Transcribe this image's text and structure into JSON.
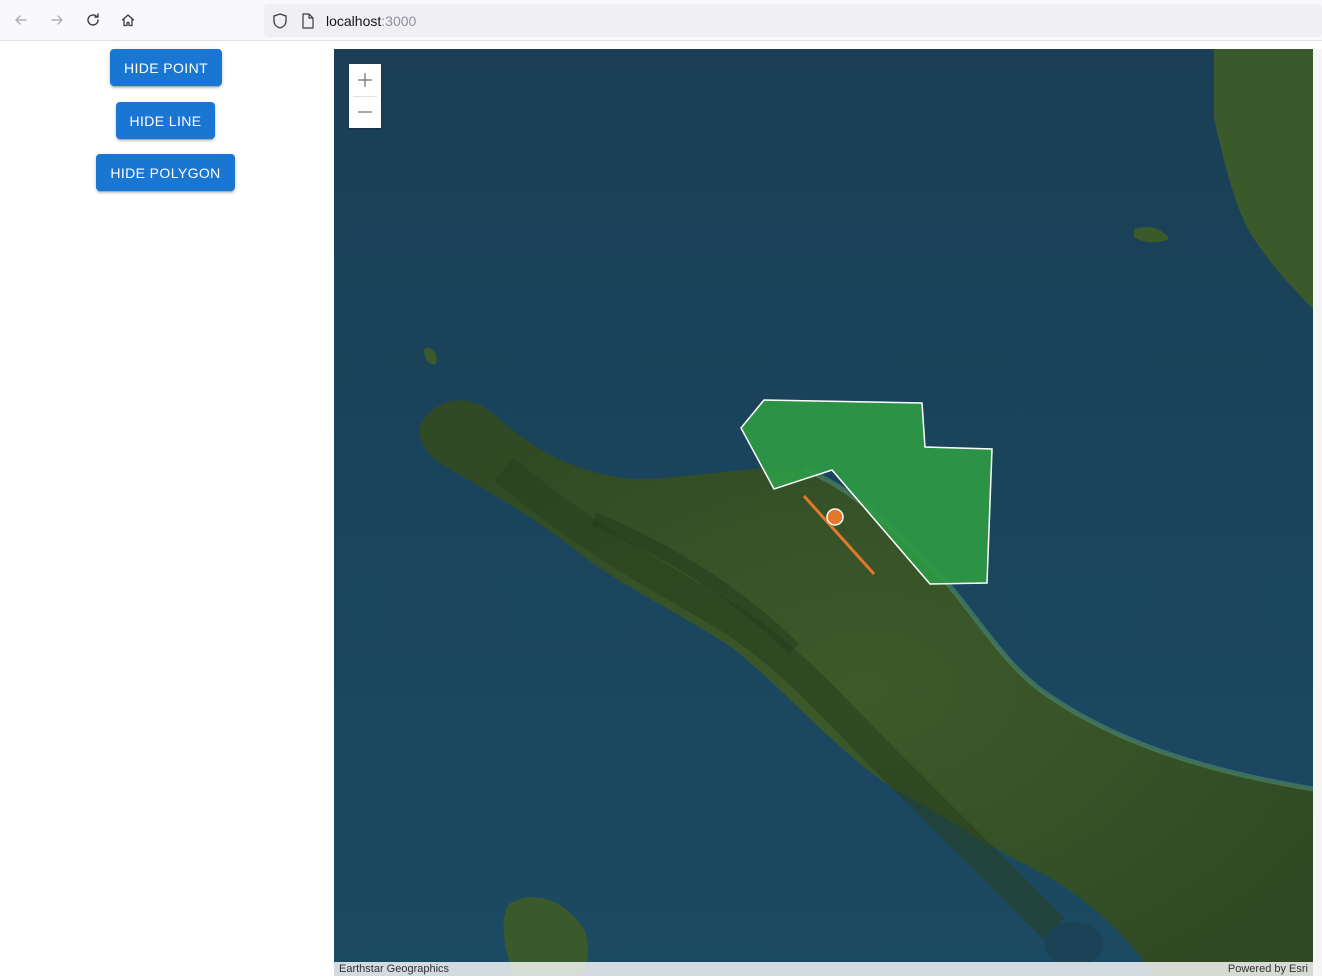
{
  "browser": {
    "url_host": "localhost",
    "url_port": ":3000"
  },
  "sidebar": {
    "buttons": [
      {
        "label": "HIDE POINT"
      },
      {
        "label": "HIDE LINE"
      },
      {
        "label": "HIDE POLYGON"
      }
    ]
  },
  "map": {
    "zoom_in_icon": "plus-icon",
    "zoom_out_icon": "minus-icon",
    "attribution_left": "Earthstar Geographics",
    "attribution_right": "Powered by Esri",
    "basemap": "satellite imagery",
    "graphics": {
      "polygon_fill": "#2e9a44",
      "polygon_outline": "#ffffff",
      "line_color": "#e3782b",
      "point_color": "#e3782b"
    }
  },
  "colors": {
    "button_bg": "#1976d2",
    "button_text": "#ffffff"
  }
}
